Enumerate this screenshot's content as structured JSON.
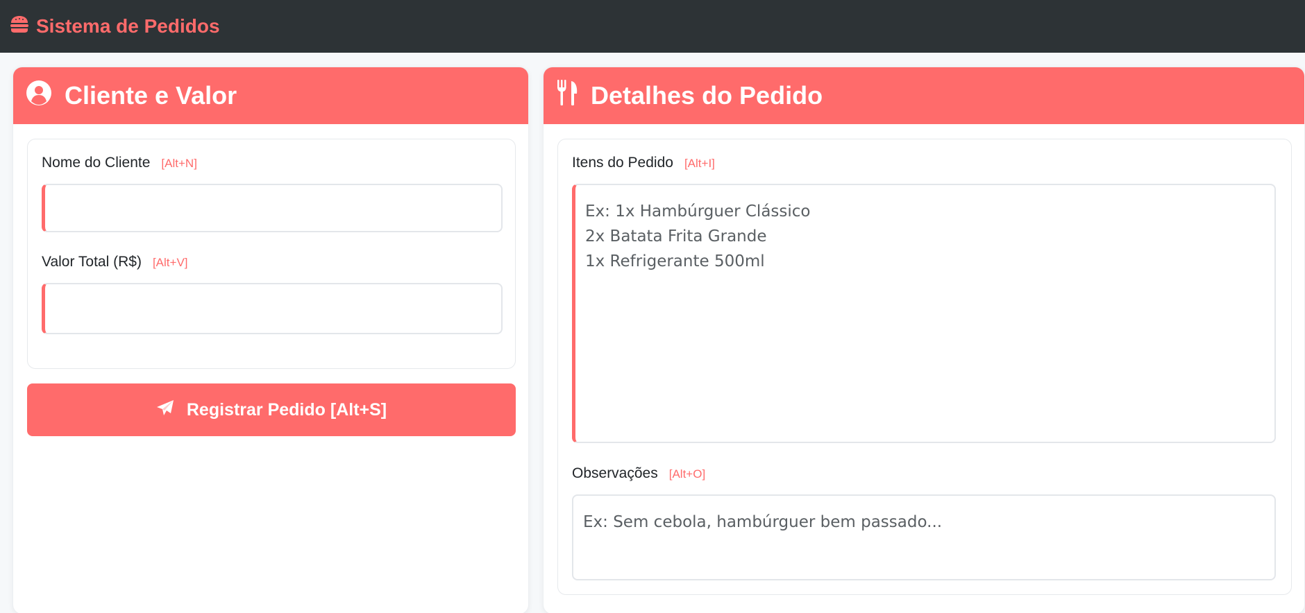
{
  "app": {
    "title": "Sistema de Pedidos",
    "icon": "burger-icon",
    "accent": "#ff6b6b",
    "navbar_bg": "#2d3336"
  },
  "left_card": {
    "title": "Cliente e Valor",
    "icon": "user-circle-icon",
    "client_name": {
      "label": "Nome do Cliente",
      "hotkey": "[Alt+N]",
      "value": "",
      "placeholder": ""
    },
    "total_value": {
      "label": "Valor Total (R$)",
      "hotkey": "[Alt+V]",
      "value": "",
      "placeholder": ""
    },
    "submit": {
      "label": "Registrar Pedido [Alt+S]",
      "icon": "paper-plane-icon"
    }
  },
  "right_card": {
    "title": "Detalhes do Pedido",
    "icon": "utensils-icon",
    "items": {
      "label": "Itens do Pedido",
      "hotkey": "[Alt+I]",
      "value": "",
      "placeholder": "Ex: 1x Hambúrguer Clássico\n2x Batata Frita Grande\n1x Refrigerante 500ml"
    },
    "notes": {
      "label": "Observações",
      "hotkey": "[Alt+O]",
      "value": "",
      "placeholder": "Ex: Sem cebola, hambúrguer bem passado..."
    }
  }
}
